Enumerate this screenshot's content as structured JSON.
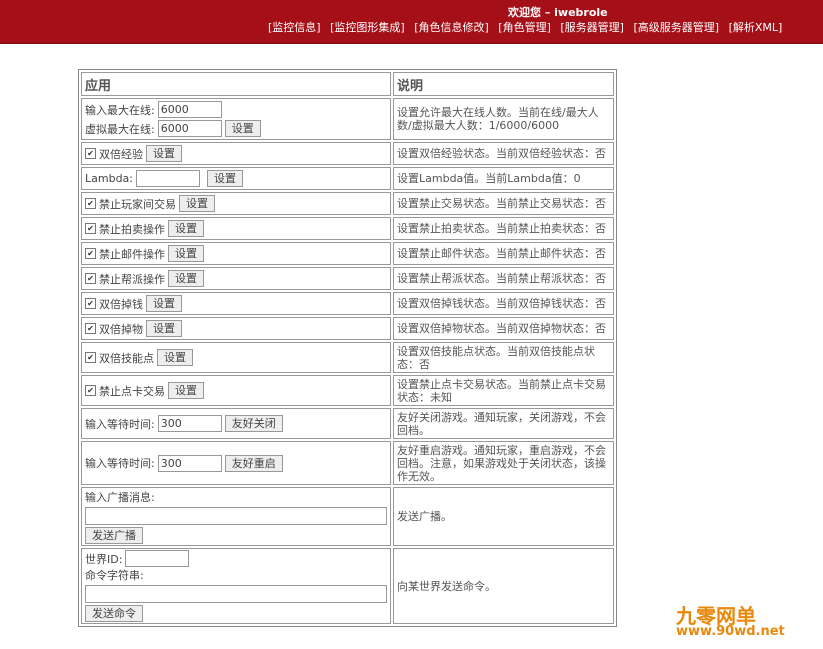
{
  "header": {
    "welcome": "欢迎您 – iwebrole",
    "nav": [
      "[监控信息]",
      "[监控图形集成]",
      "[角色信息修改]",
      "[角色管理]",
      "[服务器管理]",
      "[高级服务器管理]",
      "[解析XML]"
    ]
  },
  "table": {
    "col_app": "应用",
    "col_desc": "说明",
    "max_online": {
      "label": "输入最大在线:",
      "value": "6000"
    },
    "virtual_max": {
      "label": "虚拟最大在线:",
      "value": "6000",
      "button": "设置"
    },
    "max_online_desc": "设置允许最大在线人数。当前在线/最大人数/虚拟最大人数：1/6000/6000",
    "toggles": [
      {
        "label": "双倍经验",
        "checked": true,
        "button": "设置",
        "desc": "设置双倍经验状态。当前双倍经验状态：否"
      }
    ],
    "lambda": {
      "label": "Lambda:",
      "value": "",
      "button": "设置",
      "desc": "设置Lambda值。当前Lambda值：0"
    },
    "toggles2": [
      {
        "label": "禁止玩家间交易",
        "checked": true,
        "button": "设置",
        "desc": "设置禁止交易状态。当前禁止交易状态：否"
      },
      {
        "label": "禁止拍卖操作",
        "checked": true,
        "button": "设置",
        "desc": "设置禁止拍卖状态。当前禁止拍卖状态：否"
      },
      {
        "label": "禁止邮件操作",
        "checked": true,
        "button": "设置",
        "desc": "设置禁止邮件状态。当前禁止邮件状态：否"
      },
      {
        "label": "禁止帮派操作",
        "checked": true,
        "button": "设置",
        "desc": "设置禁止帮派状态。当前禁止帮派状态：否"
      },
      {
        "label": "双倍掉钱",
        "checked": true,
        "button": "设置",
        "desc": "设置双倍掉钱状态。当前双倍掉钱状态：否"
      },
      {
        "label": "双倍掉物",
        "checked": true,
        "button": "设置",
        "desc": "设置双倍掉物状态。当前双倍掉物状态：否"
      },
      {
        "label": "双倍技能点",
        "checked": true,
        "button": "设置",
        "desc": "设置双倍技能点状态。当前双倍技能点状态：否"
      },
      {
        "label": "禁止点卡交易",
        "checked": true,
        "button": "设置",
        "desc": "设置禁止点卡交易状态。当前禁止点卡交易状态：未知"
      }
    ],
    "shutdown": {
      "label": "输入等待时间:",
      "value": "300",
      "button": "友好关闭",
      "desc": "友好关闭游戏。通知玩家，关闭游戏，不会回档。"
    },
    "restart": {
      "label": "输入等待时间:",
      "value": "300",
      "button": "友好重启",
      "desc": "友好重启游戏。通知玩家，重启游戏，不会回档。注意，如果游戏处于关闭状态，该操作无效。"
    },
    "broadcast": {
      "label": "输入广播消息:",
      "value": "",
      "button": "发送广播",
      "desc": "发送广播。"
    },
    "world_cmd": {
      "id_label": "世界ID:",
      "id_value": "",
      "cmd_label": "命令字符串:",
      "cmd_value": "",
      "button": "发送命令",
      "desc": "向某世界发送命令。"
    }
  },
  "watermark": {
    "title": "九零网单",
    "url": "www.90wd.net"
  }
}
